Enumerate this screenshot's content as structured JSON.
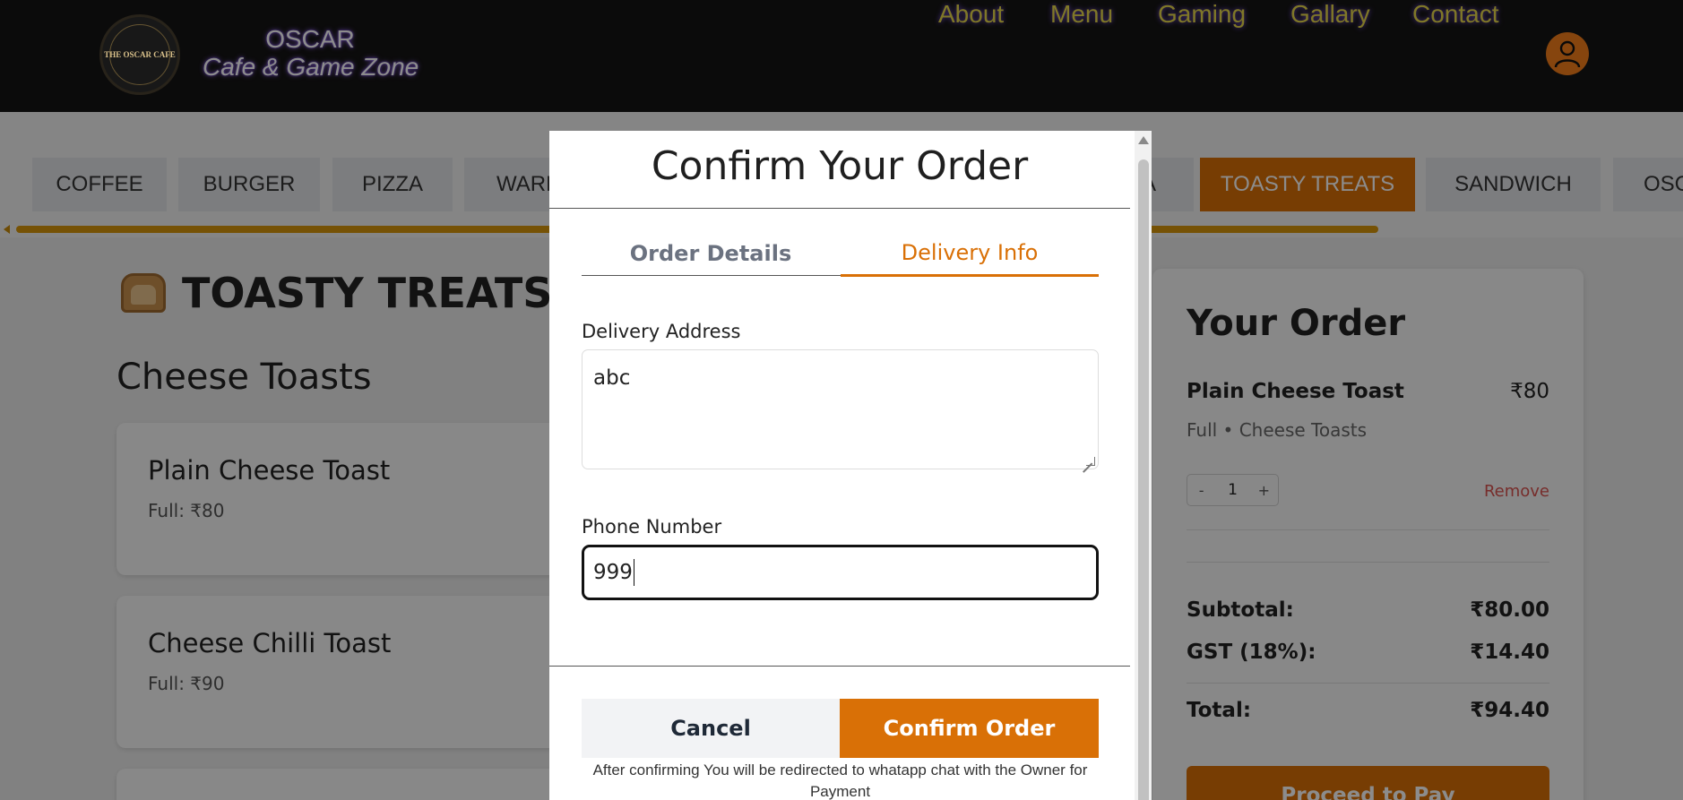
{
  "header": {
    "logo_text": "THE OSCAR CAFE",
    "brand_top": "OSCAR",
    "brand_sub": "Cafe & Game Zone",
    "nav": [
      "About",
      "Menu",
      "Gaming",
      "Gallary",
      "Contact"
    ]
  },
  "categories": [
    {
      "label": "COFFEE"
    },
    {
      "label": "BURGER"
    },
    {
      "label": "PIZZA"
    },
    {
      "label": "WARM"
    },
    {
      "label": "A"
    },
    {
      "label": "TOASTY TREATS"
    },
    {
      "label": "SANDWICH"
    },
    {
      "label": "OSC"
    }
  ],
  "main": {
    "section_title": "TOASTY TREATS",
    "subsection_title": "Cheese Toasts",
    "items": [
      {
        "name": "Plain Cheese Toast",
        "price": "Full: ₹80"
      },
      {
        "name": "Cheese Chilli Toast",
        "price": "Full: ₹90"
      }
    ]
  },
  "order": {
    "title": "Your Order",
    "item_name": "Plain Cheese Toast",
    "item_price": "₹80",
    "item_meta": "Full • Cheese Toasts",
    "qty_minus": "-",
    "qty": "1",
    "qty_plus": "+",
    "remove": "Remove",
    "subtotal_label": "Subtotal:",
    "subtotal_value": "₹80.00",
    "gst_label": "GST (18%):",
    "gst_value": "₹14.40",
    "total_label": "Total:",
    "total_value": "₹94.40",
    "pay_button": "Proceed to Pay"
  },
  "modal": {
    "title": "Confirm Your Order",
    "tabs": [
      "Order Details",
      "Delivery Info"
    ],
    "address_label": "Delivery Address",
    "address_value": "abc",
    "phone_label": "Phone Number",
    "phone_value": "999",
    "cancel": "Cancel",
    "confirm": "Confirm Order",
    "note": "After confirming You will be redirected to whatapp chat with the Owner for Payment"
  },
  "colors": {
    "accent": "#d97006",
    "header_bg": "#141414",
    "nav_text": "#e8d94a",
    "remove_text": "#d9534f"
  }
}
